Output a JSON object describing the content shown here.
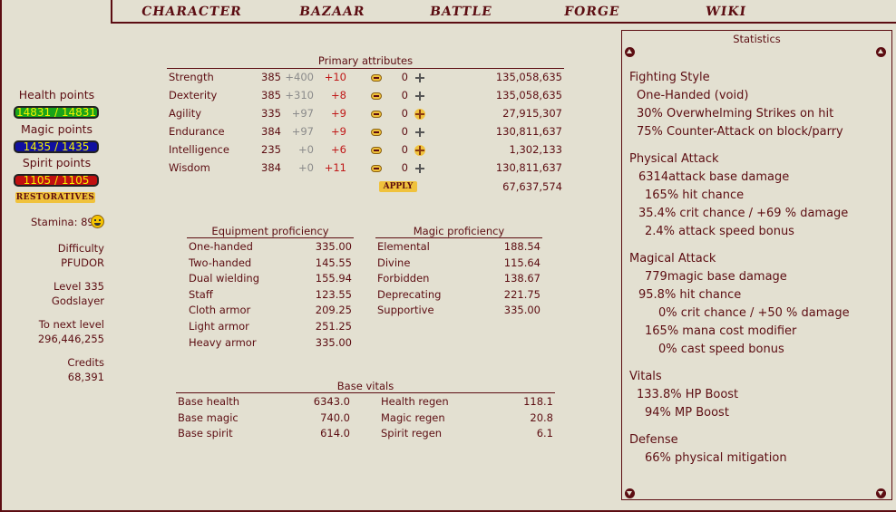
{
  "nav": [
    "CHARACTER",
    "BAZAAR",
    "BATTLE",
    "FORGE",
    "WIKI"
  ],
  "vitals_bars": {
    "health_label": "Health points",
    "health_value": "14831 / 14831",
    "health_color": "#1aa31a",
    "magic_label": "Magic points",
    "magic_value": "1435 / 1435",
    "magic_color": "#1010a0",
    "spirit_label": "Spirit points",
    "spirit_value": "1105 / 1105",
    "spirit_color": "#c01010",
    "restoratives_label": "RESTORATIVES"
  },
  "left_info": {
    "stamina": "Stamina: 89",
    "difficulty_label": "Difficulty",
    "difficulty_value": "PFUDOR",
    "level": "Level 335",
    "title": "Godslayer",
    "to_next_label": "To next level",
    "to_next_value": "296,446,255",
    "credits_label": "Credits",
    "credits_value": "68,391"
  },
  "primary": {
    "title": "Primary attributes",
    "rows": [
      {
        "name": "Strength",
        "base": "385",
        "bonus": "+400",
        "mod": "+10",
        "alloc": "0",
        "plus": "grey",
        "exp": "135,058,635"
      },
      {
        "name": "Dexterity",
        "base": "385",
        "bonus": "+310",
        "mod": "+8",
        "alloc": "0",
        "plus": "grey",
        "exp": "135,058,635"
      },
      {
        "name": "Agility",
        "base": "335",
        "bonus": "+97",
        "mod": "+9",
        "alloc": "0",
        "plus": "gold",
        "exp": "27,915,307"
      },
      {
        "name": "Endurance",
        "base": "384",
        "bonus": "+97",
        "mod": "+9",
        "alloc": "0",
        "plus": "grey",
        "exp": "130,811,637"
      },
      {
        "name": "Intelligence",
        "base": "235",
        "bonus": "+0",
        "mod": "+6",
        "alloc": "0",
        "plus": "gold",
        "exp": "1,302,133"
      },
      {
        "name": "Wisdom",
        "base": "384",
        "bonus": "+0",
        "mod": "+11",
        "alloc": "0",
        "plus": "grey",
        "exp": "130,811,637"
      }
    ],
    "apply_label": "APPLY",
    "total_exp": "67,637,574"
  },
  "equipment": {
    "title": "Equipment proficiency",
    "rows": [
      {
        "name": "One-handed",
        "value": "335.00"
      },
      {
        "name": "Two-handed",
        "value": "145.55"
      },
      {
        "name": "Dual wielding",
        "value": "155.94"
      },
      {
        "name": "Staff",
        "value": "123.55"
      },
      {
        "name": "Cloth armor",
        "value": "209.25"
      },
      {
        "name": "Light armor",
        "value": "251.25"
      },
      {
        "name": "Heavy armor",
        "value": "335.00"
      }
    ]
  },
  "magic": {
    "title": "Magic proficiency",
    "rows": [
      {
        "name": "Elemental",
        "value": "188.54"
      },
      {
        "name": "Divine",
        "value": "115.64"
      },
      {
        "name": "Forbidden",
        "value": "138.67"
      },
      {
        "name": "Deprecating",
        "value": "221.75"
      },
      {
        "name": "Supportive",
        "value": "335.00"
      }
    ]
  },
  "base_vitals": {
    "title": "Base vitals",
    "rows": [
      {
        "name": "Base health",
        "value": "6343.0",
        "regen_name": "Health regen",
        "regen_value": "118.1"
      },
      {
        "name": "Base magic",
        "value": "740.0",
        "regen_name": "Magic regen",
        "regen_value": "20.8"
      },
      {
        "name": "Base spirit",
        "value": "614.0",
        "regen_name": "Spirit regen",
        "regen_value": "6.1"
      }
    ]
  },
  "statistics": {
    "title": "Statistics",
    "lines": [
      {
        "text": "Fighting Style",
        "indent": 0
      },
      {
        "text": "One-Handed (void)",
        "indent": 1
      },
      {
        "text": "30% Overwhelming Strikes on hit",
        "indent": 1
      },
      {
        "text": "75% Counter-Attack on block/parry",
        "indent": 1
      },
      {
        "text": "Physical Attack",
        "indent": 0
      },
      {
        "text": "6314attack base damage",
        "indent": 2
      },
      {
        "text": "165% hit chance",
        "indent": 3
      },
      {
        "text": "35.4% crit chance / +69 % damage",
        "indent": 2
      },
      {
        "text": "2.4% attack speed bonus",
        "indent": 3
      },
      {
        "text": "Magical Attack",
        "indent": 0
      },
      {
        "text": "779magic base damage",
        "indent": 3
      },
      {
        "text": "95.8% hit chance",
        "indent": 2
      },
      {
        "text": "0% crit chance / +50 % damage",
        "indent": 4
      },
      {
        "text": "165% mana cost modifier",
        "indent": 3
      },
      {
        "text": "0% cast speed bonus",
        "indent": 4
      },
      {
        "text": "Vitals",
        "indent": 0
      },
      {
        "text": "133.8% HP Boost",
        "indent": 1
      },
      {
        "text": "94% MP Boost",
        "indent": 3
      },
      {
        "text": "Defense",
        "indent": 0
      },
      {
        "text": "66% physical mitigation",
        "indent": 3
      }
    ]
  }
}
